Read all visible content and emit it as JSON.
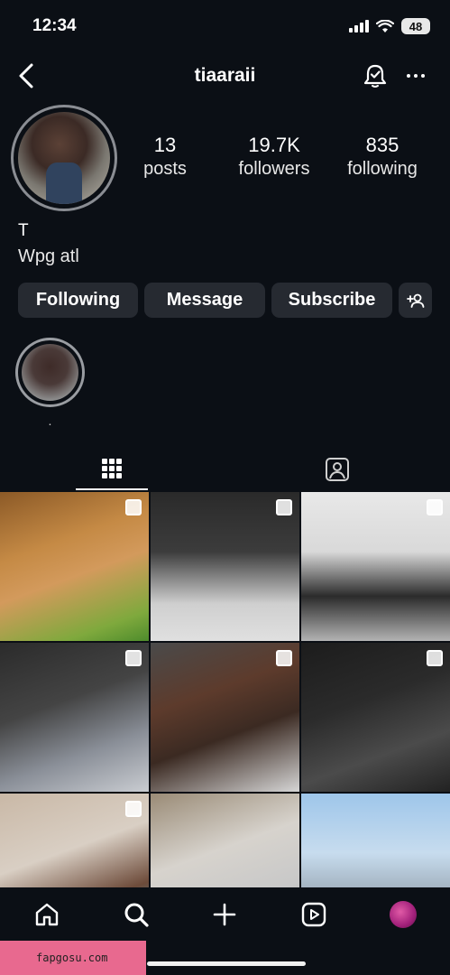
{
  "status_bar": {
    "time": "12:34",
    "battery": "48"
  },
  "profile": {
    "username": "tiaaraii",
    "name": "T",
    "bio": "Wpg atl",
    "stats": [
      {
        "value": "13",
        "label": "posts"
      },
      {
        "value": "19.7K",
        "label": "followers"
      },
      {
        "value": "835",
        "label": "following"
      }
    ]
  },
  "actions": {
    "following_label": "Following",
    "message_label": "Message",
    "subscribe_label": "Subscribe"
  },
  "highlights": [
    {
      "label": "."
    }
  ],
  "tabs": [
    {
      "icon": "grid-icon",
      "active": true
    },
    {
      "icon": "tagged-icon",
      "active": false
    }
  ],
  "posts_count_visible": 9,
  "bottom_nav": [
    "home-icon",
    "search-icon",
    "create-icon",
    "reels-icon",
    "profile-avatar"
  ],
  "watermark": "fapgosu.com",
  "colors": {
    "background": "#0b0f15",
    "button": "#262a31",
    "text": "#ffffff"
  }
}
